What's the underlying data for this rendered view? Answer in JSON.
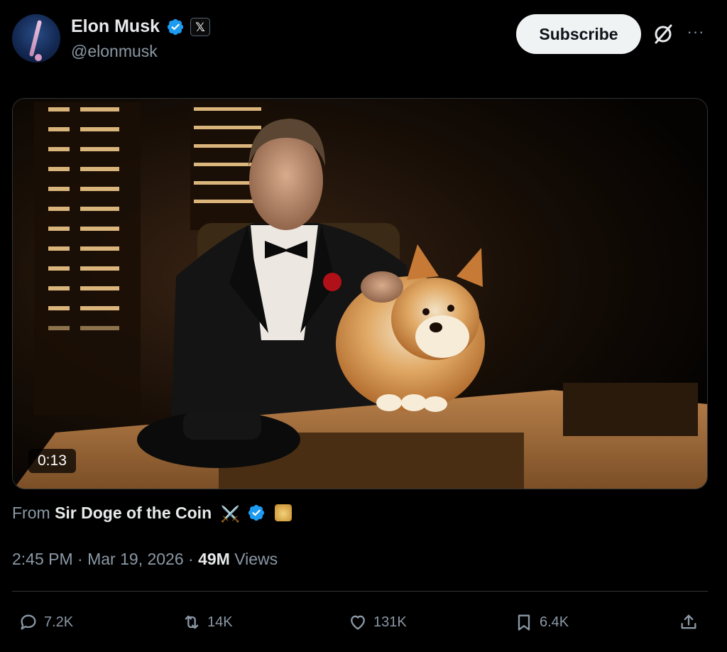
{
  "author": {
    "name": "Elon Musk",
    "handle": "@elonmusk",
    "badge_glyph": "𝕏",
    "verified_color": "#1d9bf0"
  },
  "header": {
    "subscribe_label": "Subscribe",
    "more_label": "···"
  },
  "media": {
    "duration": "0:13"
  },
  "attribution": {
    "prefix": "From",
    "name": "Sir Doge of the Coin",
    "emoji": "⚔️"
  },
  "meta": {
    "time": "2:45 PM",
    "separator1": "·",
    "date": "Mar 19, 2026",
    "separator2": "·",
    "views_count": "49M",
    "views_label": "Views"
  },
  "actions": {
    "replies": "7.2K",
    "reposts": "14K",
    "likes": "131K",
    "bookmarks": "6.4K"
  },
  "colors": {
    "background": "#000000",
    "text_primary": "#e7e9ea",
    "text_secondary": "#8b98a5",
    "border": "#2f3336",
    "accent": "#1d9bf0"
  }
}
